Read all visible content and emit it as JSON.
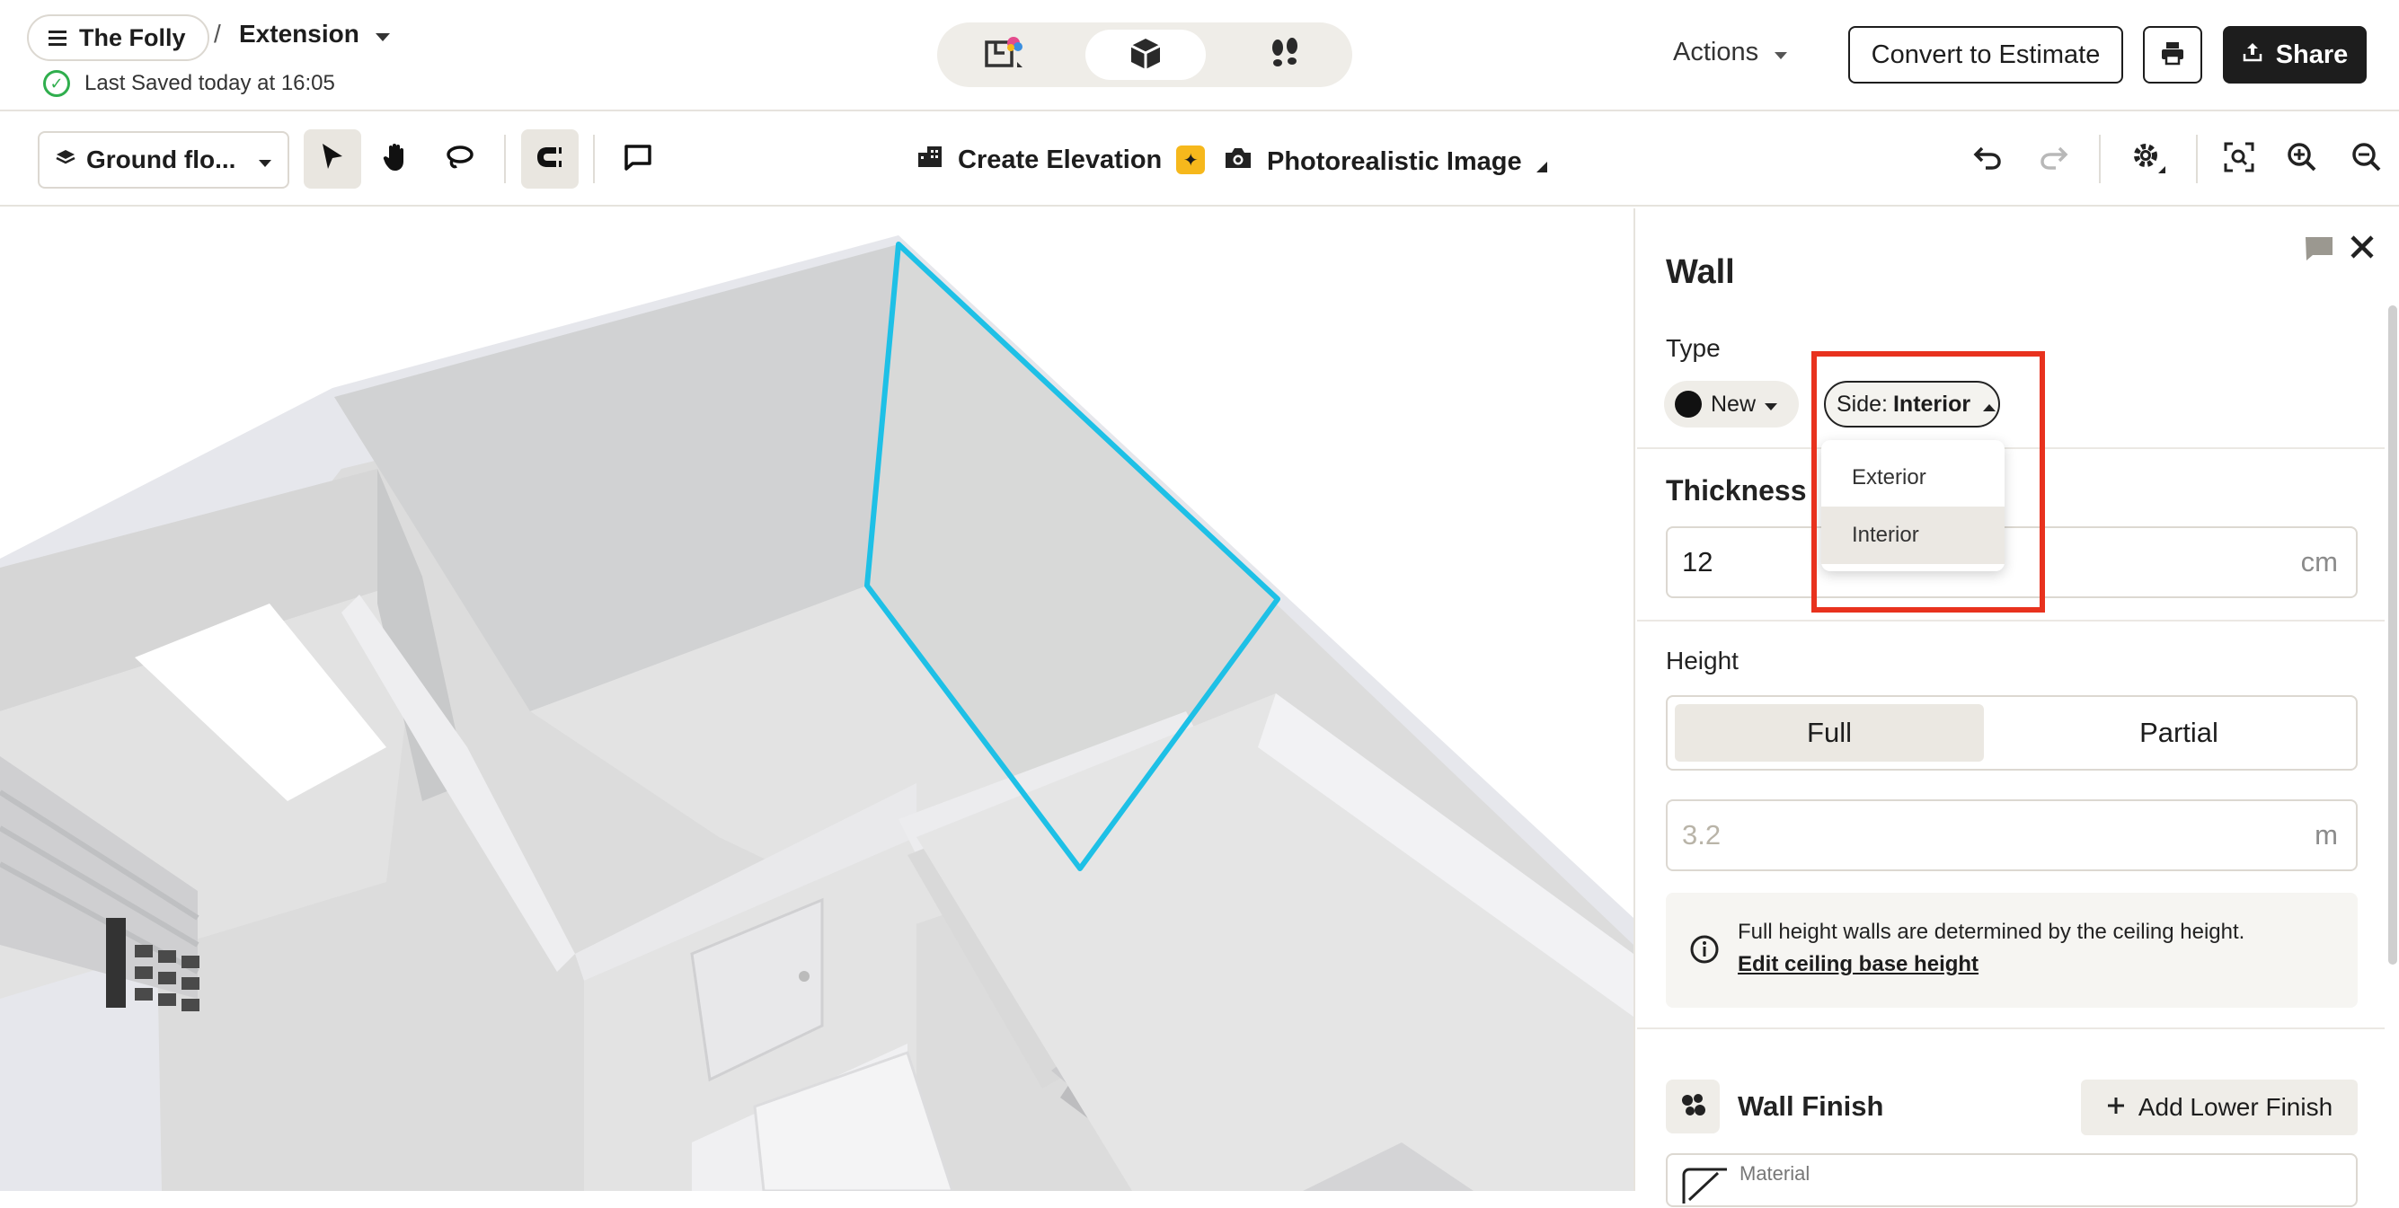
{
  "header": {
    "project": "The Folly",
    "separator": "/",
    "page": "Extension",
    "saved_status": "Last Saved today at 16:05",
    "actions_label": "Actions",
    "convert_label": "Convert to Estimate",
    "share_label": "Share",
    "view_modes": [
      "floor-plan-view",
      "3d-view",
      "walkthrough-view"
    ],
    "active_view": "3d-view"
  },
  "toolbar": {
    "floor_label": "Ground flo...",
    "create_elevation_label": "Create Elevation",
    "photo_label": "Photorealistic Image"
  },
  "panel": {
    "title": "Wall",
    "type_label": "Type",
    "type_value": "New",
    "side_prefix": "Side:",
    "side_value": "Interior",
    "side_options": [
      "Exterior",
      "Interior"
    ],
    "thickness_label": "Thickness",
    "thickness_value": "12",
    "thickness_unit": "cm",
    "height_label": "Height",
    "height_full": "Full",
    "height_partial": "Partial",
    "height_value": "3.2",
    "height_unit": "m",
    "info_text": "Full height walls are determined by the ceiling height.",
    "info_link": "Edit ceiling base height",
    "wall_finish_label": "Wall Finish",
    "add_lower_finish": "Add Lower Finish",
    "material_label": "Material"
  },
  "colors": {
    "selection": "#1ec0e6",
    "highlight": "#e8321e",
    "accent": "#f6b81c"
  }
}
